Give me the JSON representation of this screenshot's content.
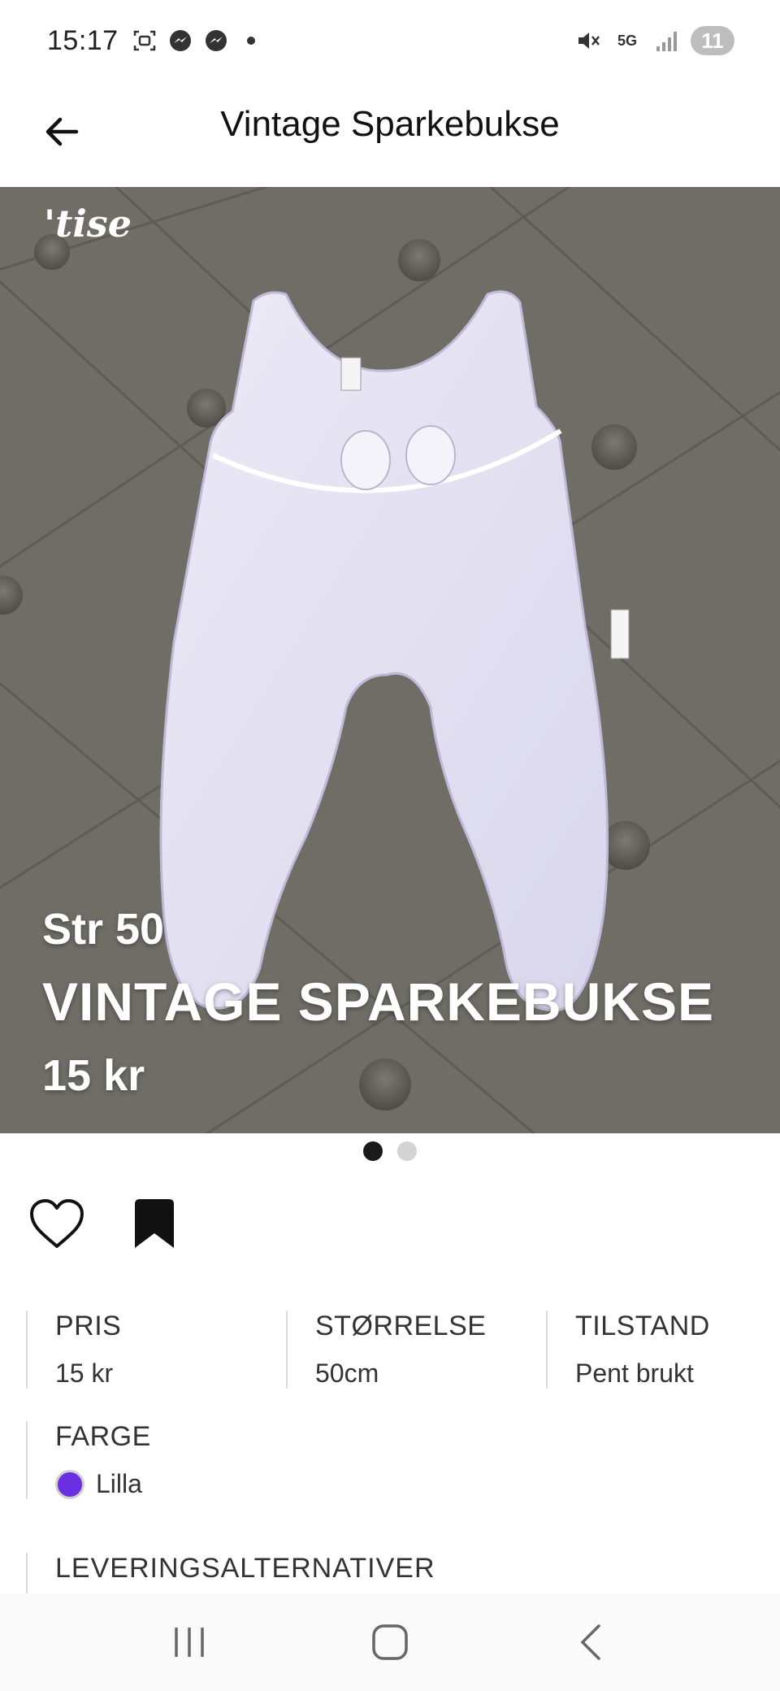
{
  "status_bar": {
    "time": "15:17",
    "network": "5G",
    "battery": "11",
    "icons": [
      "screenshot-icon",
      "messenger-icon",
      "messenger-icon",
      "dot-icon",
      "mute-icon",
      "network-5g-icon",
      "signal-icon",
      "battery-icon"
    ]
  },
  "app_bar": {
    "title": "Vintage Sparkebukse",
    "back_icon": "arrow-left-icon"
  },
  "hero": {
    "logo": "'tise",
    "size_text": "Str 50",
    "name": "VINTAGE SPARKEBUKSE",
    "price": "15 kr",
    "image_count": 2,
    "active_index": 0
  },
  "actions": {
    "like_icon": "heart-outline-icon",
    "save_icon": "bookmark-filled-icon"
  },
  "details": {
    "price": {
      "label": "PRIS",
      "value": "15 kr"
    },
    "size": {
      "label": "STØRRELSE",
      "value": "50cm"
    },
    "condition": {
      "label": "TILSTAND",
      "value": "Pent brukt"
    },
    "color": {
      "label": "FARGE",
      "value": "Lilla",
      "swatch": "#6a2fe0"
    },
    "delivery": {
      "label": "LEVERINGSALTERNATIVER"
    }
  },
  "colors": {
    "hero_bg": "#6f6d66",
    "active_dot": "#1a1a1a",
    "inactive_dot": "#d3d3d3"
  }
}
